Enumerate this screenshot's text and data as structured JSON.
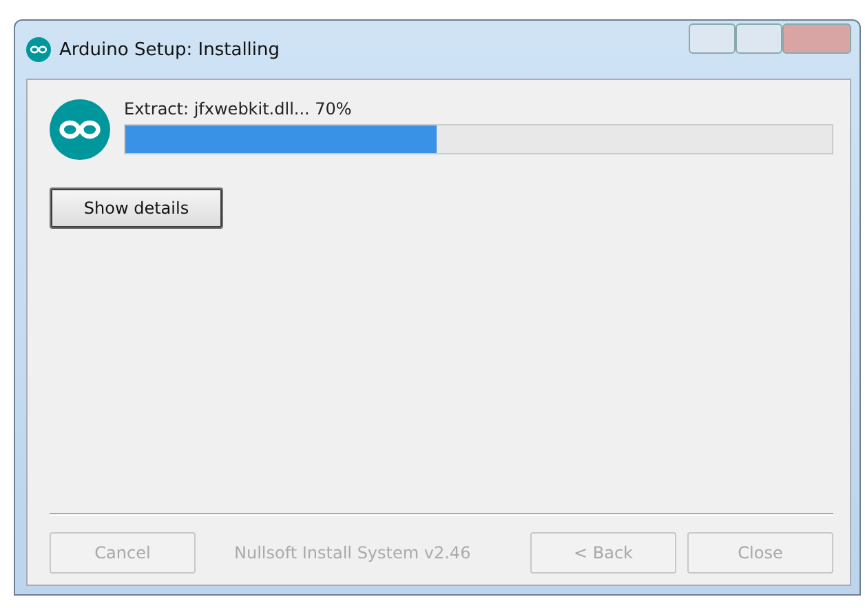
{
  "window": {
    "title": "Arduino Setup: Installing"
  },
  "progress": {
    "status": "Extract: jfxwebkit.dll... 70%",
    "level": 0.44
  },
  "details_button": {
    "label": "Show details",
    "disabled": false
  },
  "footer": {
    "brand": "Nullsoft Install System v2.46"
  },
  "buttons": [
    {
      "label": "Cancel",
      "disabled": true
    },
    {
      "label": "< Back",
      "disabled": true
    },
    {
      "label": "Close",
      "disabled": true
    }
  ]
}
